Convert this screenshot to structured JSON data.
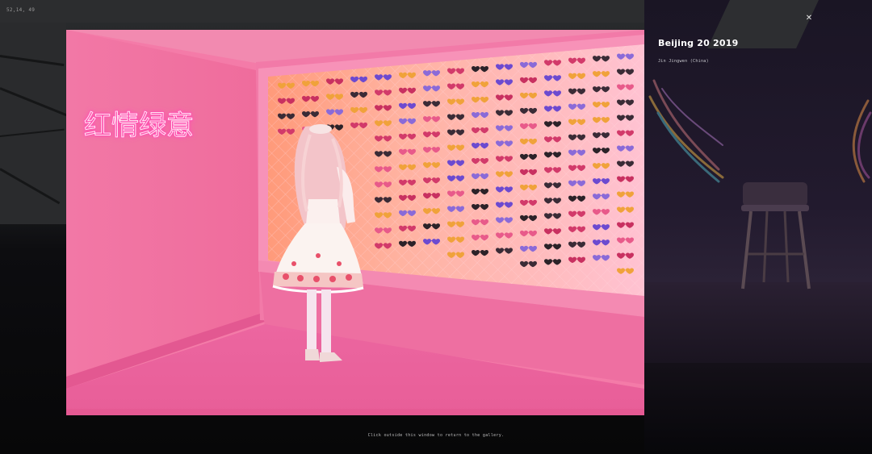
{
  "overlay": {
    "coordinates_text": "52,14, 49",
    "footer_hint": "Click outside this window to return to the gallery."
  },
  "photo": {
    "title": "Beijing 20 2019",
    "credit": "Jin Jingwen (China)",
    "neon_sign_text": "红情绿意",
    "alt": "Girl in a lolita dress looking at a wall of heart-shaped sunglasses in a pink room"
  },
  "controls": {
    "close_icon": "close-icon",
    "close_glyph": "✕"
  },
  "colors": {
    "room_pink": "#f57aa8",
    "wall_pink": "#f06c9e",
    "floor_pink": "#e9609a",
    "neon_text": "#ffe8f4",
    "neon_glow": "#ff4fb0",
    "overlay_bg": "#0a0a0c",
    "caption_text": "#ffffff"
  }
}
